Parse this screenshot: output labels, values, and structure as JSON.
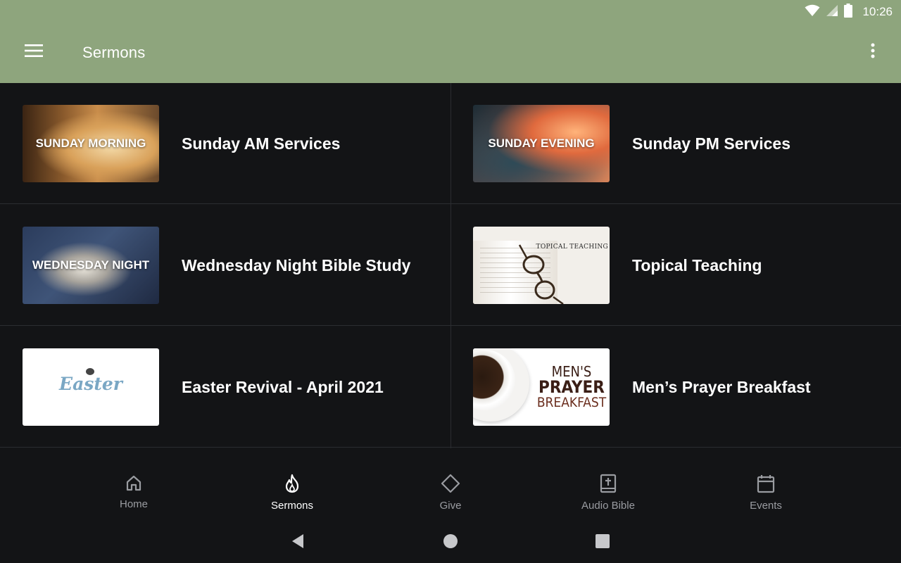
{
  "status_bar": {
    "time": "10:26",
    "icons": [
      "wifi-icon",
      "signal-icon",
      "battery-icon"
    ]
  },
  "app_bar": {
    "title": "Sermons",
    "menu_icon": "menu-icon",
    "more_icon": "more-vert-icon",
    "background": "#8ea57d"
  },
  "sermon_series": [
    {
      "title": "Sunday AM Services",
      "thumbnail_text": "SUNDAY MORNING"
    },
    {
      "title": "Sunday PM Services",
      "thumbnail_text": "SUNDAY EVENING"
    },
    {
      "title": "Wednesday Night Bible Study",
      "thumbnail_text": "WEDNESDAY NIGHT"
    },
    {
      "title": "Topical Teaching",
      "thumbnail_text": "TOPICAL TEACHING"
    },
    {
      "title": "Easter Revival - April 2021",
      "thumbnail_text": "Easter"
    },
    {
      "title": "Men’s Prayer Breakfast",
      "thumbnail_text": [
        "MEN'S",
        "PRAYER",
        "BREAKFAST"
      ]
    }
  ],
  "bottom_nav": [
    {
      "label": "Home",
      "icon": "home-icon",
      "active": false
    },
    {
      "label": "Sermons",
      "icon": "flame-icon",
      "active": true
    },
    {
      "label": "Give",
      "icon": "diamond-icon",
      "active": false
    },
    {
      "label": "Audio Bible",
      "icon": "bible-icon",
      "active": false
    },
    {
      "label": "Events",
      "icon": "calendar-icon",
      "active": false
    }
  ],
  "system_nav": {
    "back_icon": "back-icon",
    "home_icon": "home-circle-icon",
    "recents_icon": "recents-icon"
  }
}
